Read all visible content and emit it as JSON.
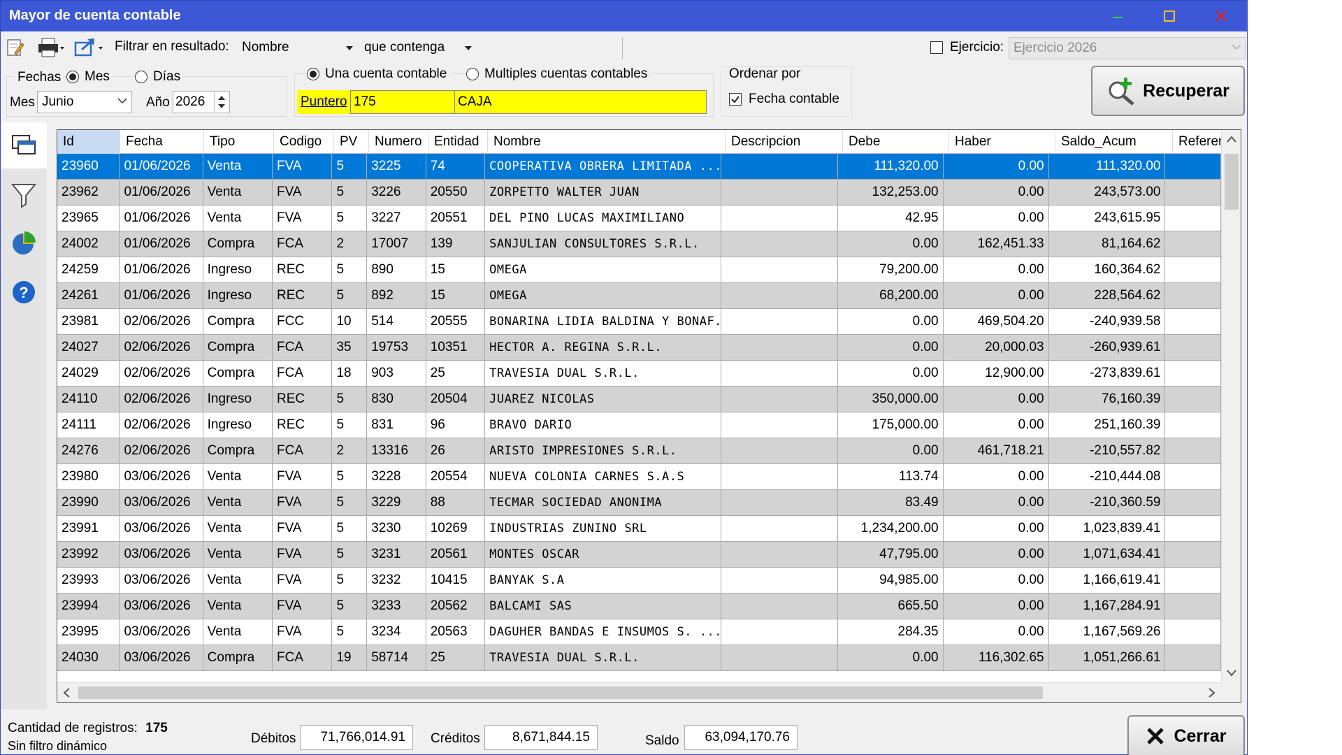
{
  "window": {
    "title": "Mayor de cuenta contable"
  },
  "toolbar": {
    "filter_label": "Filtrar en resultado:",
    "filter_field": "Nombre",
    "filter_op": "que contenga",
    "ejercicio_label": "Ejercicio:",
    "ejercicio_value": "Ejercicio 2026"
  },
  "fechas": {
    "label": "Fechas",
    "mes_option": "Mes",
    "dias_option": "Días",
    "mes_label": "Mes",
    "mes_value": "Junio",
    "anio_label": "Año",
    "anio_value": "2026"
  },
  "cuenta": {
    "una_option": "Una cuenta contable",
    "multiples_option": "Multiples cuentas contables",
    "puntero_label": "Puntero",
    "puntero_value": "175",
    "cuenta_name": "CAJA"
  },
  "ordenar": {
    "title": "Ordenar por",
    "fecha_contable": "Fecha contable"
  },
  "recuperar_label": "Recuperar",
  "grid": {
    "columns": [
      "Id",
      "Fecha",
      "Tipo",
      "Codigo",
      "PV",
      "Numero",
      "Entidad",
      "Nombre",
      "Descripcion",
      "Debe",
      "Haber",
      "Saldo_Acum",
      "Referenc"
    ],
    "rows": [
      [
        "23960",
        "01/06/2026",
        "Venta",
        "FVA",
        "5",
        "3225",
        "74",
        "COOPERATIVA OBRERA LIMITADA ...",
        "",
        "111,320.00",
        "0.00",
        "111,320.00",
        ""
      ],
      [
        "23962",
        "01/06/2026",
        "Venta",
        "FVA",
        "5",
        "3226",
        "20550",
        "ZORPETTO WALTER JUAN",
        "",
        "132,253.00",
        "0.00",
        "243,573.00",
        ""
      ],
      [
        "23965",
        "01/06/2026",
        "Venta",
        "FVA",
        "5",
        "3227",
        "20551",
        "DEL PINO LUCAS MAXIMILIANO",
        "",
        "42.95",
        "0.00",
        "243,615.95",
        ""
      ],
      [
        "24002",
        "01/06/2026",
        "Compra",
        "FCA",
        "2",
        "17007",
        "139",
        "SANJULIAN CONSULTORES S.R.L.",
        "",
        "0.00",
        "162,451.33",
        "81,164.62",
        ""
      ],
      [
        "24259",
        "01/06/2026",
        "Ingreso",
        "REC",
        "5",
        "890",
        "15",
        "OMEGA",
        "",
        "79,200.00",
        "0.00",
        "160,364.62",
        ""
      ],
      [
        "24261",
        "01/06/2026",
        "Ingreso",
        "REC",
        "5",
        "892",
        "15",
        "OMEGA",
        "",
        "68,200.00",
        "0.00",
        "228,564.62",
        ""
      ],
      [
        "23981",
        "02/06/2026",
        "Compra",
        "FCC",
        "10",
        "514",
        "20555",
        "BONARINA LIDIA BALDINA Y BONAF...",
        "",
        "0.00",
        "469,504.20",
        "-240,939.58",
        ""
      ],
      [
        "24027",
        "02/06/2026",
        "Compra",
        "FCA",
        "35",
        "19753",
        "10351",
        "HECTOR A. REGINA S.R.L.",
        "",
        "0.00",
        "20,000.03",
        "-260,939.61",
        ""
      ],
      [
        "24029",
        "02/06/2026",
        "Compra",
        "FCA",
        "18",
        "903",
        "25",
        "TRAVESIA DUAL S.R.L.",
        "",
        "0.00",
        "12,900.00",
        "-273,839.61",
        ""
      ],
      [
        "24110",
        "02/06/2026",
        "Ingreso",
        "REC",
        "5",
        "830",
        "20504",
        "JUAREZ NICOLAS",
        "",
        "350,000.00",
        "0.00",
        "76,160.39",
        ""
      ],
      [
        "24111",
        "02/06/2026",
        "Ingreso",
        "REC",
        "5",
        "831",
        "96",
        "BRAVO DARIO",
        "",
        "175,000.00",
        "0.00",
        "251,160.39",
        ""
      ],
      [
        "24276",
        "02/06/2026",
        "Compra",
        "FCA",
        "2",
        "13316",
        "26",
        "ARISTO IMPRESIONES S.R.L.",
        "",
        "0.00",
        "461,718.21",
        "-210,557.82",
        ""
      ],
      [
        "23980",
        "03/06/2026",
        "Venta",
        "FVA",
        "5",
        "3228",
        "20554",
        "NUEVA COLONIA CARNES S.A.S",
        "",
        "113.74",
        "0.00",
        "-210,444.08",
        ""
      ],
      [
        "23990",
        "03/06/2026",
        "Venta",
        "FVA",
        "5",
        "3229",
        "88",
        "TECMAR SOCIEDAD ANONIMA",
        "",
        "83.49",
        "0.00",
        "-210,360.59",
        ""
      ],
      [
        "23991",
        "03/06/2026",
        "Venta",
        "FVA",
        "5",
        "3230",
        "10269",
        "INDUSTRIAS ZUNINO SRL",
        "",
        "1,234,200.00",
        "0.00",
        "1,023,839.41",
        ""
      ],
      [
        "23992",
        "03/06/2026",
        "Venta",
        "FVA",
        "5",
        "3231",
        "20561",
        "MONTES OSCAR",
        "",
        "47,795.00",
        "0.00",
        "1,071,634.41",
        ""
      ],
      [
        "23993",
        "03/06/2026",
        "Venta",
        "FVA",
        "5",
        "3232",
        "10415",
        "BANYAK S.A",
        "",
        "94,985.00",
        "0.00",
        "1,166,619.41",
        ""
      ],
      [
        "23994",
        "03/06/2026",
        "Venta",
        "FVA",
        "5",
        "3233",
        "20562",
        "BALCAMI SAS",
        "",
        "665.50",
        "0.00",
        "1,167,284.91",
        ""
      ],
      [
        "23995",
        "03/06/2026",
        "Venta",
        "FVA",
        "5",
        "3234",
        "20563",
        "DAGUHER BANDAS E INSUMOS S. ...",
        "",
        "284.35",
        "0.00",
        "1,167,569.26",
        ""
      ],
      [
        "24030",
        "03/06/2026",
        "Compra",
        "FCA",
        "19",
        "58714",
        "25",
        "TRAVESIA DUAL S.R.L.",
        "",
        "0.00",
        "116,302.65",
        "1,051,266.61",
        ""
      ]
    ]
  },
  "footer": {
    "cantidad_label": "Cantidad de registros:",
    "cantidad_value": "175",
    "filtro_text": "Sin filtro dinámico",
    "debitos_label": "Débitos",
    "debitos_value": "71,766,014.91",
    "creditos_label": "Créditos",
    "creditos_value": "8,671,844.15",
    "saldo_label": "Saldo",
    "saldo_value": "63,094,170.76",
    "cerrar_label": "Cerrar"
  },
  "colors": {
    "titlebar": "#3c58d6",
    "selection": "#0078d7",
    "highlight": "#ffff00",
    "alt_row": "#d3d3d3"
  }
}
